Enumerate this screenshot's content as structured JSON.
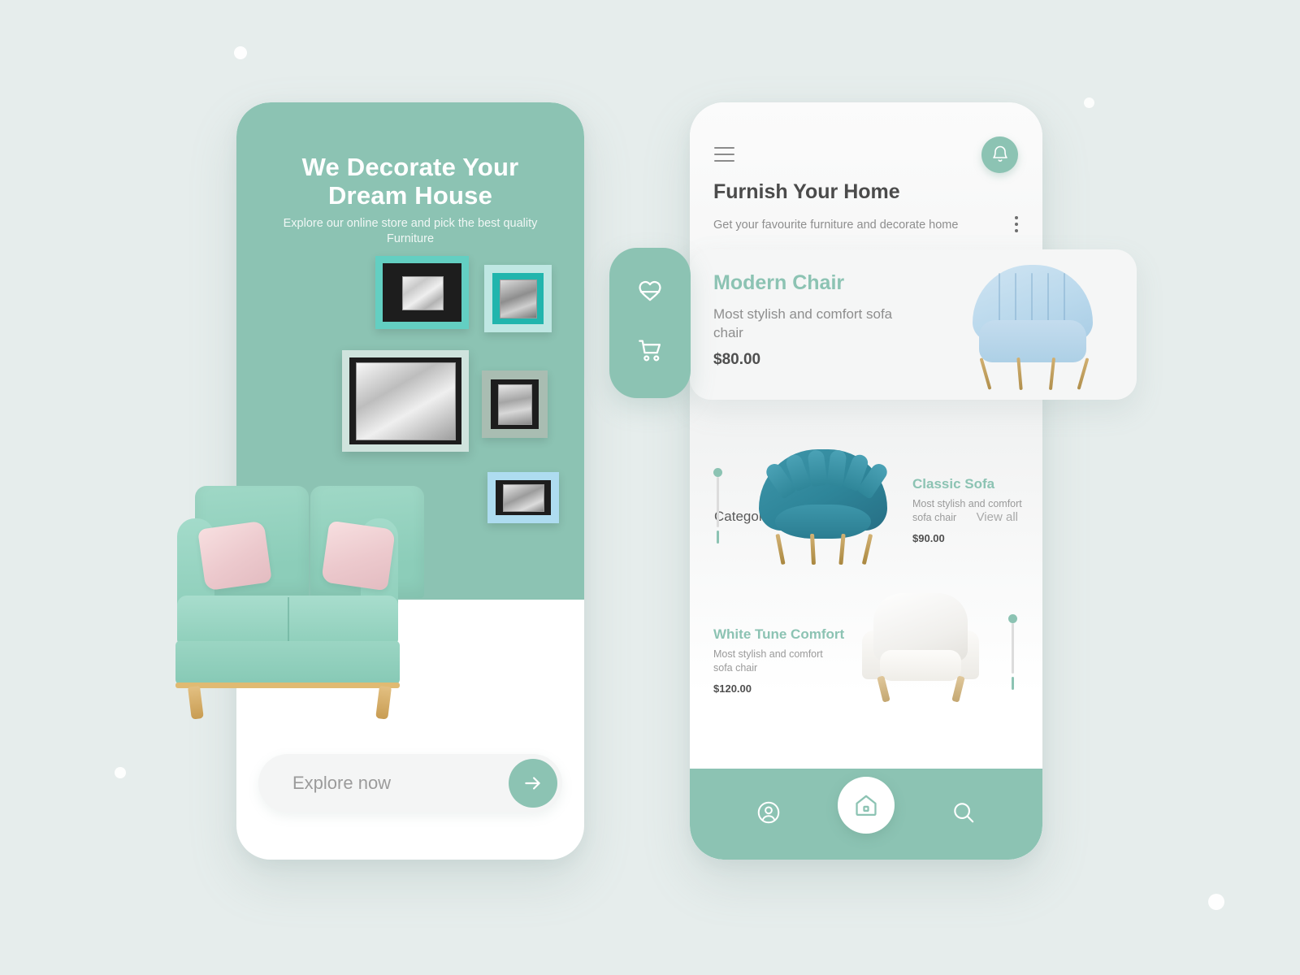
{
  "theme": {
    "brand_green": "#8cc3b3",
    "page_background": "#e6edec",
    "card_background": "#f5f6f6",
    "text_dark": "#4b4b4b",
    "text_muted": "#8e8e8e"
  },
  "onboarding": {
    "headline": "We Decorate Your Dream House",
    "subheadline": "Explore our online store and pick the best quality Furniture",
    "cta": {
      "label": "Explore now",
      "arrow_icon": "arrow-right-icon"
    },
    "wall_art": [
      {
        "id": "frame-a",
        "icon": "picture-frame-icon"
      },
      {
        "id": "frame-b",
        "icon": "picture-frame-icon"
      },
      {
        "id": "frame-c",
        "icon": "picture-frame-icon"
      },
      {
        "id": "frame-d",
        "icon": "picture-frame-icon"
      },
      {
        "id": "frame-e",
        "icon": "picture-frame-icon"
      }
    ],
    "hero_image": "mint-sofa-image"
  },
  "side_panel": {
    "actions": [
      {
        "icon": "heart-icon",
        "name": "favourites"
      },
      {
        "icon": "cart-icon",
        "name": "shopping-cart"
      }
    ]
  },
  "home": {
    "topbar": {
      "menu_icon": "hamburger-menu-icon",
      "notification_icon": "bell-icon"
    },
    "title": "Furnish Your Home",
    "subtitle": "Get your favourite furniture and decorate home",
    "more_icon": "kebab-menu-icon",
    "featured": {
      "name": "Modern Chair",
      "description": "Most stylish and comfort sofa chair",
      "price": "$80.00",
      "image": "light-blue-tub-chair-image"
    },
    "categorise": {
      "title": "Categorise",
      "view_all": "View all"
    },
    "products": [
      {
        "name": "Classic Sofa",
        "description": "Most stylish and comfort sofa chair",
        "price": "$90.00",
        "image": "teal-shell-chair-image"
      },
      {
        "name": "White Tune Comfort",
        "description": "Most stylish and comfort sofa chair",
        "price": "$120.00",
        "image": "white-armchair-image"
      }
    ],
    "bottom_nav": [
      {
        "icon": "user-icon",
        "name": "profile",
        "active": false
      },
      {
        "icon": "home-icon",
        "name": "home",
        "active": true
      },
      {
        "icon": "search-icon",
        "name": "search",
        "active": false
      }
    ]
  }
}
